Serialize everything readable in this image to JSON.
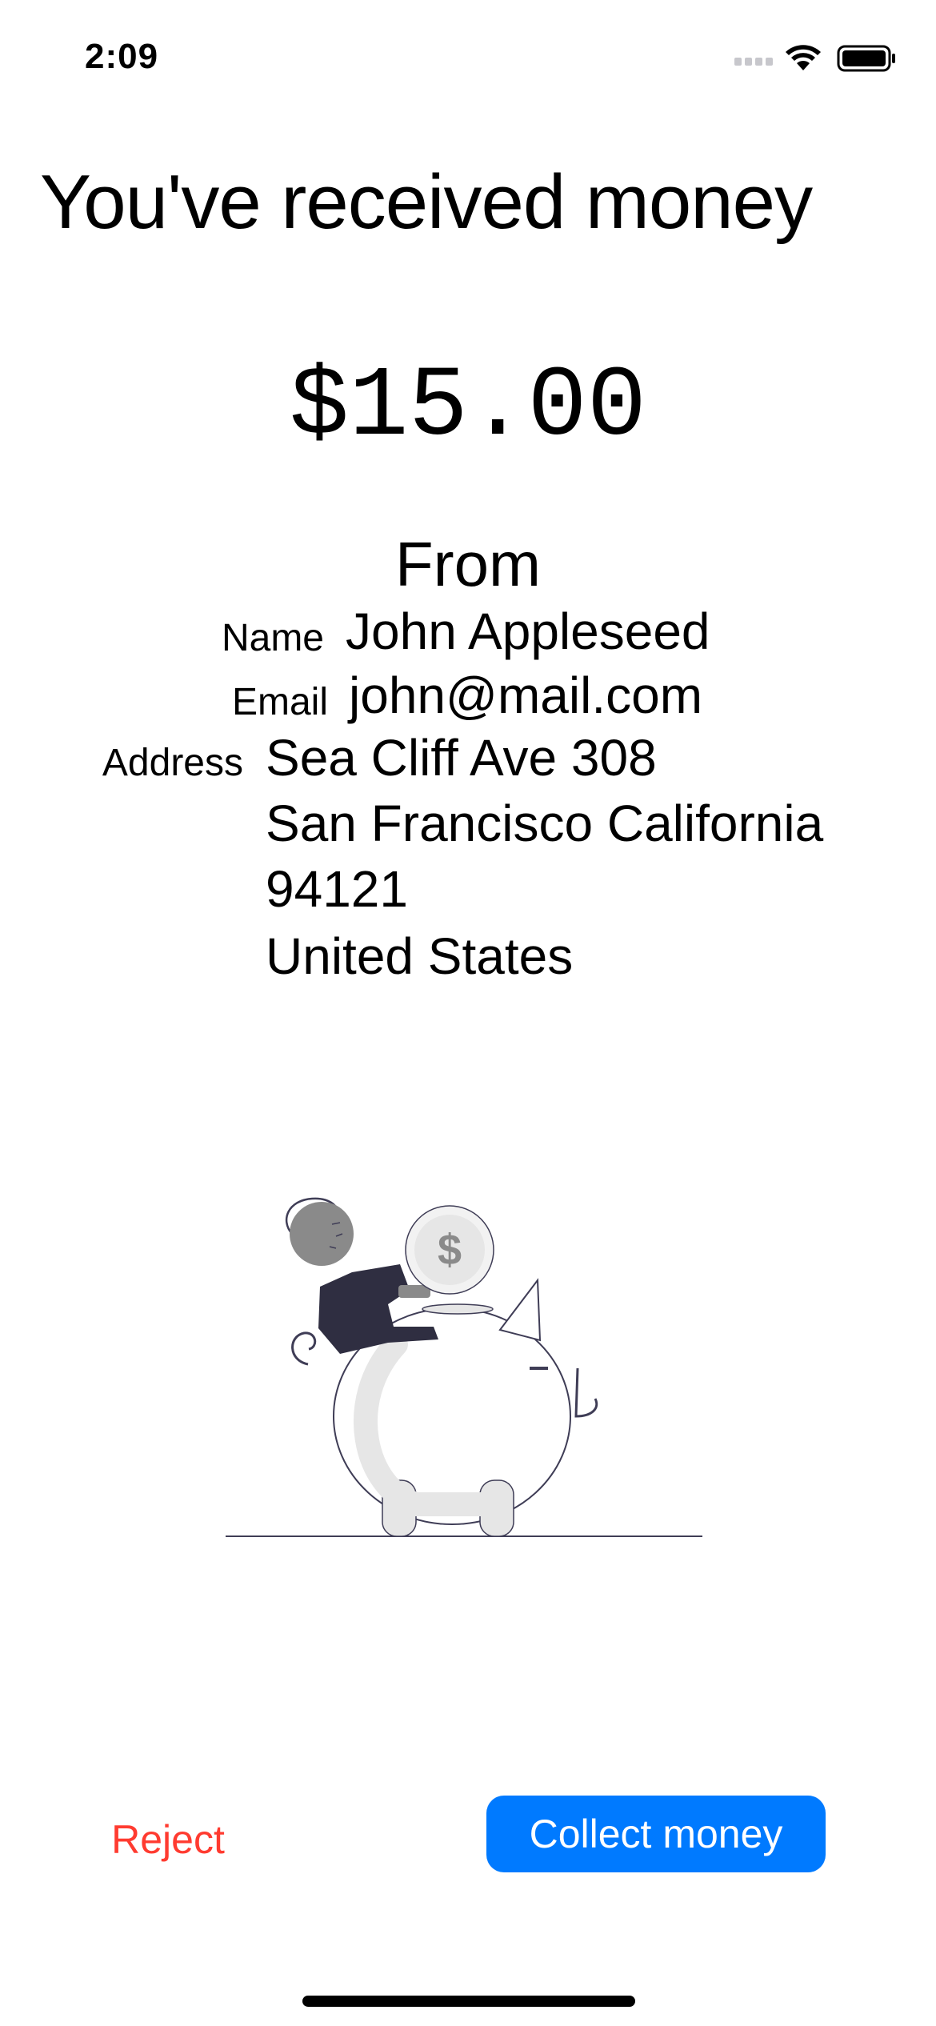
{
  "status_bar": {
    "time": "2:09",
    "icons": [
      "signal-icon",
      "wifi-icon",
      "battery-icon"
    ]
  },
  "page": {
    "title": "You've received money",
    "amount": "$15.00",
    "from_heading": "From"
  },
  "sender": {
    "name_label": "Name",
    "name": "John Appleseed",
    "email_label": "Email",
    "email": "john@mail.com",
    "address_label": "Address",
    "address_line1": "Sea Cliff Ave 308",
    "address_line2": "San Francisco  California",
    "address_line3": "94121",
    "address_line4": "United States"
  },
  "illustration": {
    "icon": "piggy-bank-illustration",
    "coin_symbol": "$"
  },
  "actions": {
    "reject_label": "Reject",
    "collect_label": "Collect money"
  },
  "colors": {
    "accent": "#007aff",
    "destructive": "#ff3b30",
    "text": "#000000",
    "background": "#ffffff"
  }
}
